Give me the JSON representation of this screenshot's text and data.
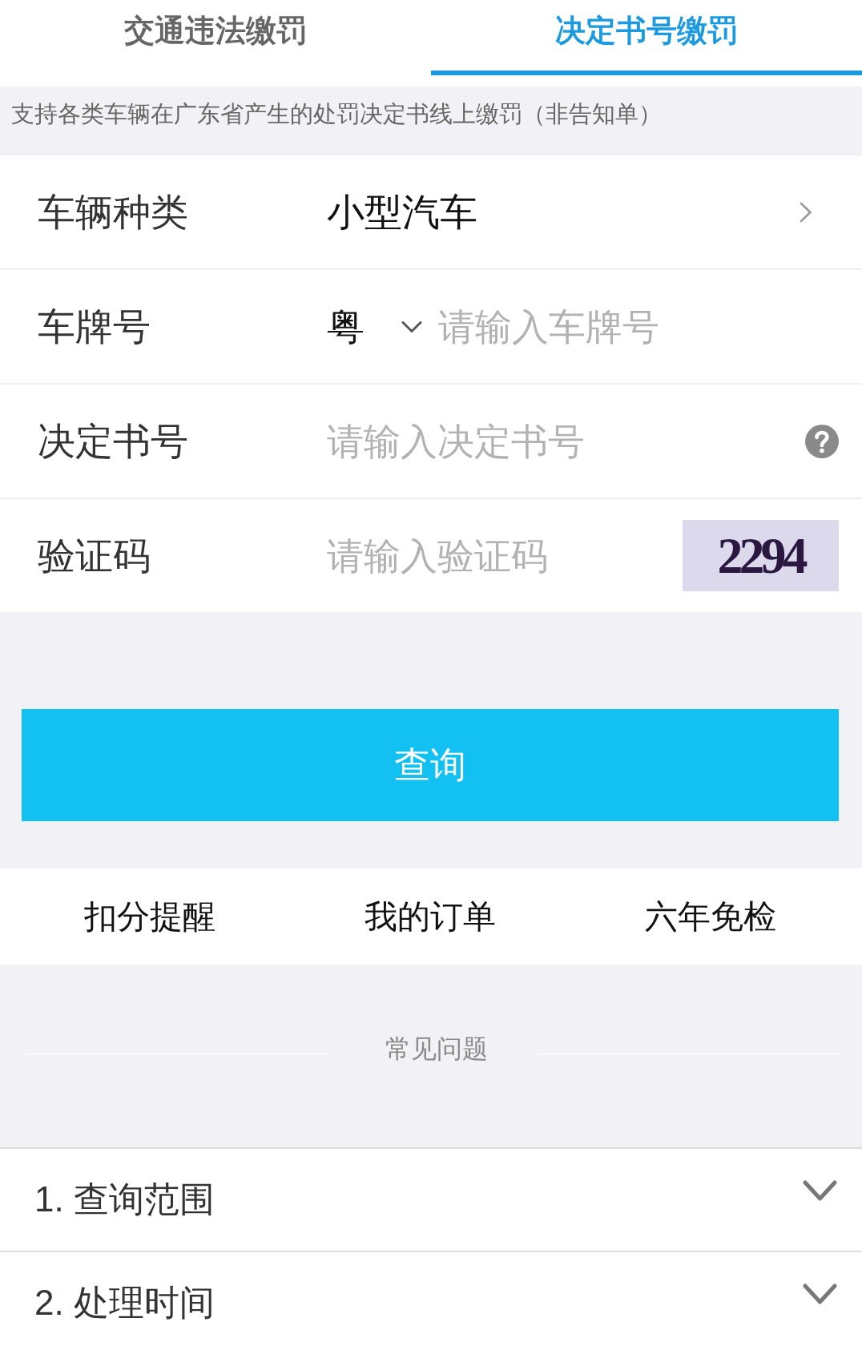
{
  "tabs": [
    {
      "label": "交通违法缴罚",
      "selected": false
    },
    {
      "label": "决定书号缴罚",
      "selected": true
    }
  ],
  "notice": "支持各类车辆在广东省产生的处罚决定书线上缴罚（非告知单）",
  "form": {
    "rows": [
      {
        "kind": "select",
        "label": "车辆种类",
        "value": "小型汽车"
      },
      {
        "kind": "plate",
        "label": "车牌号",
        "province": "粤",
        "placeholder": "请输入车牌号"
      },
      {
        "kind": "help",
        "label": "决定书号",
        "placeholder": "请输入决定书号"
      },
      {
        "kind": "captcha",
        "label": "验证码",
        "placeholder": "请输入验证码",
        "captcha": "2294"
      }
    ]
  },
  "query_button": "查询",
  "shortcuts": [
    "扣分提醒",
    "我的订单",
    "六年免检"
  ],
  "faq": {
    "title": "常见问题",
    "items": [
      {
        "label": "1. 查询范围",
        "expanded": false
      },
      {
        "label": "2. 处理时间",
        "expanded": false
      }
    ]
  }
}
